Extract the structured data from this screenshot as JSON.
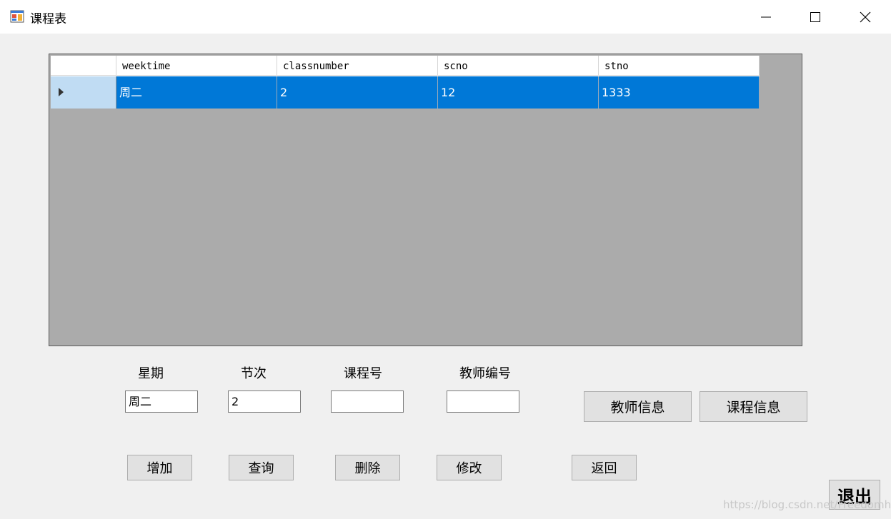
{
  "window": {
    "title": "课程表"
  },
  "grid": {
    "columns": [
      "weektime",
      "classnumber",
      "scno",
      "stno"
    ],
    "rows": [
      {
        "weektime": "周二",
        "classnumber": "2",
        "scno": "12",
        "stno": "1333"
      }
    ]
  },
  "form": {
    "labels": {
      "weekday": "星期",
      "period": "节次",
      "course_no": "课程号",
      "teacher_no": "教师编号"
    },
    "values": {
      "weekday": "周二",
      "period": "2",
      "course_no": "",
      "teacher_no": ""
    }
  },
  "buttons": {
    "teacher_info": "教师信息",
    "course_info": "课程信息",
    "add": "增加",
    "query": "查询",
    "delete": "删除",
    "modify": "修改",
    "back": "返回",
    "exit": "退出"
  },
  "watermark": "https://blog.csdn.net/Freedomhy",
  "colors": {
    "selection": "#0078d7",
    "grid_background": "#ababab",
    "window_background": "#f0f0f0"
  }
}
